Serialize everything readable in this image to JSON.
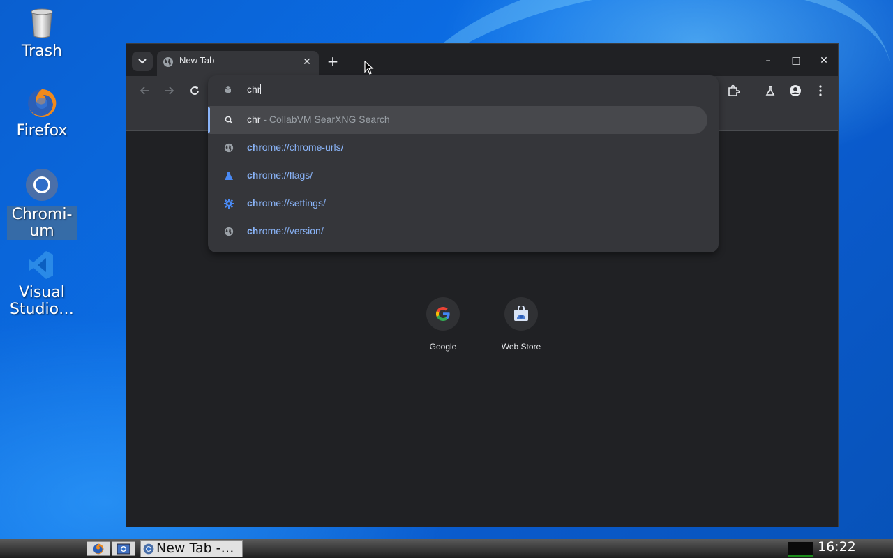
{
  "desktop": {
    "icons": [
      {
        "label": "Trash",
        "icon": "trash-icon"
      },
      {
        "label": "Firefox",
        "icon": "firefox-icon"
      },
      {
        "label": "Chromi-",
        "label2": "um",
        "icon": "chromium-icon"
      },
      {
        "label": "Visual",
        "label2": "Studio…",
        "icon": "visual-studio-icon"
      }
    ]
  },
  "browser": {
    "tab": {
      "title": "New Tab",
      "icon": "globe-icon",
      "close_symbol": "✕"
    },
    "new_tab_symbol": "+",
    "window_controls": {
      "minimize": "–",
      "maximize": "□",
      "close": "✕"
    },
    "omnibox": {
      "typed": "chr",
      "suggestions": [
        {
          "icon": "search-icon",
          "match": "chr",
          "rest": " - CollabVM SearXNG Search",
          "kind": "query"
        },
        {
          "icon": "globe-icon",
          "match": "chr",
          "rest": "ome://chrome-urls/",
          "kind": "url"
        },
        {
          "icon": "flask-icon",
          "match": "chr",
          "rest": "ome://flags/",
          "kind": "url"
        },
        {
          "icon": "gear-icon",
          "match": "chr",
          "rest": "ome://settings/",
          "kind": "url"
        },
        {
          "icon": "globe-icon",
          "match": "chr",
          "rest": "ome://version/",
          "kind": "url"
        }
      ]
    },
    "shortcuts": [
      {
        "name": "Google",
        "icon": "google-icon"
      },
      {
        "name": "Web Store",
        "icon": "web-store-icon"
      }
    ]
  },
  "taskbar": {
    "task_title": "New Tab -…",
    "clock": "16:22"
  },
  "colors": {
    "accent": "#8ab4f8",
    "window_bg": "#202124",
    "toolbar_bg": "#35363a"
  }
}
